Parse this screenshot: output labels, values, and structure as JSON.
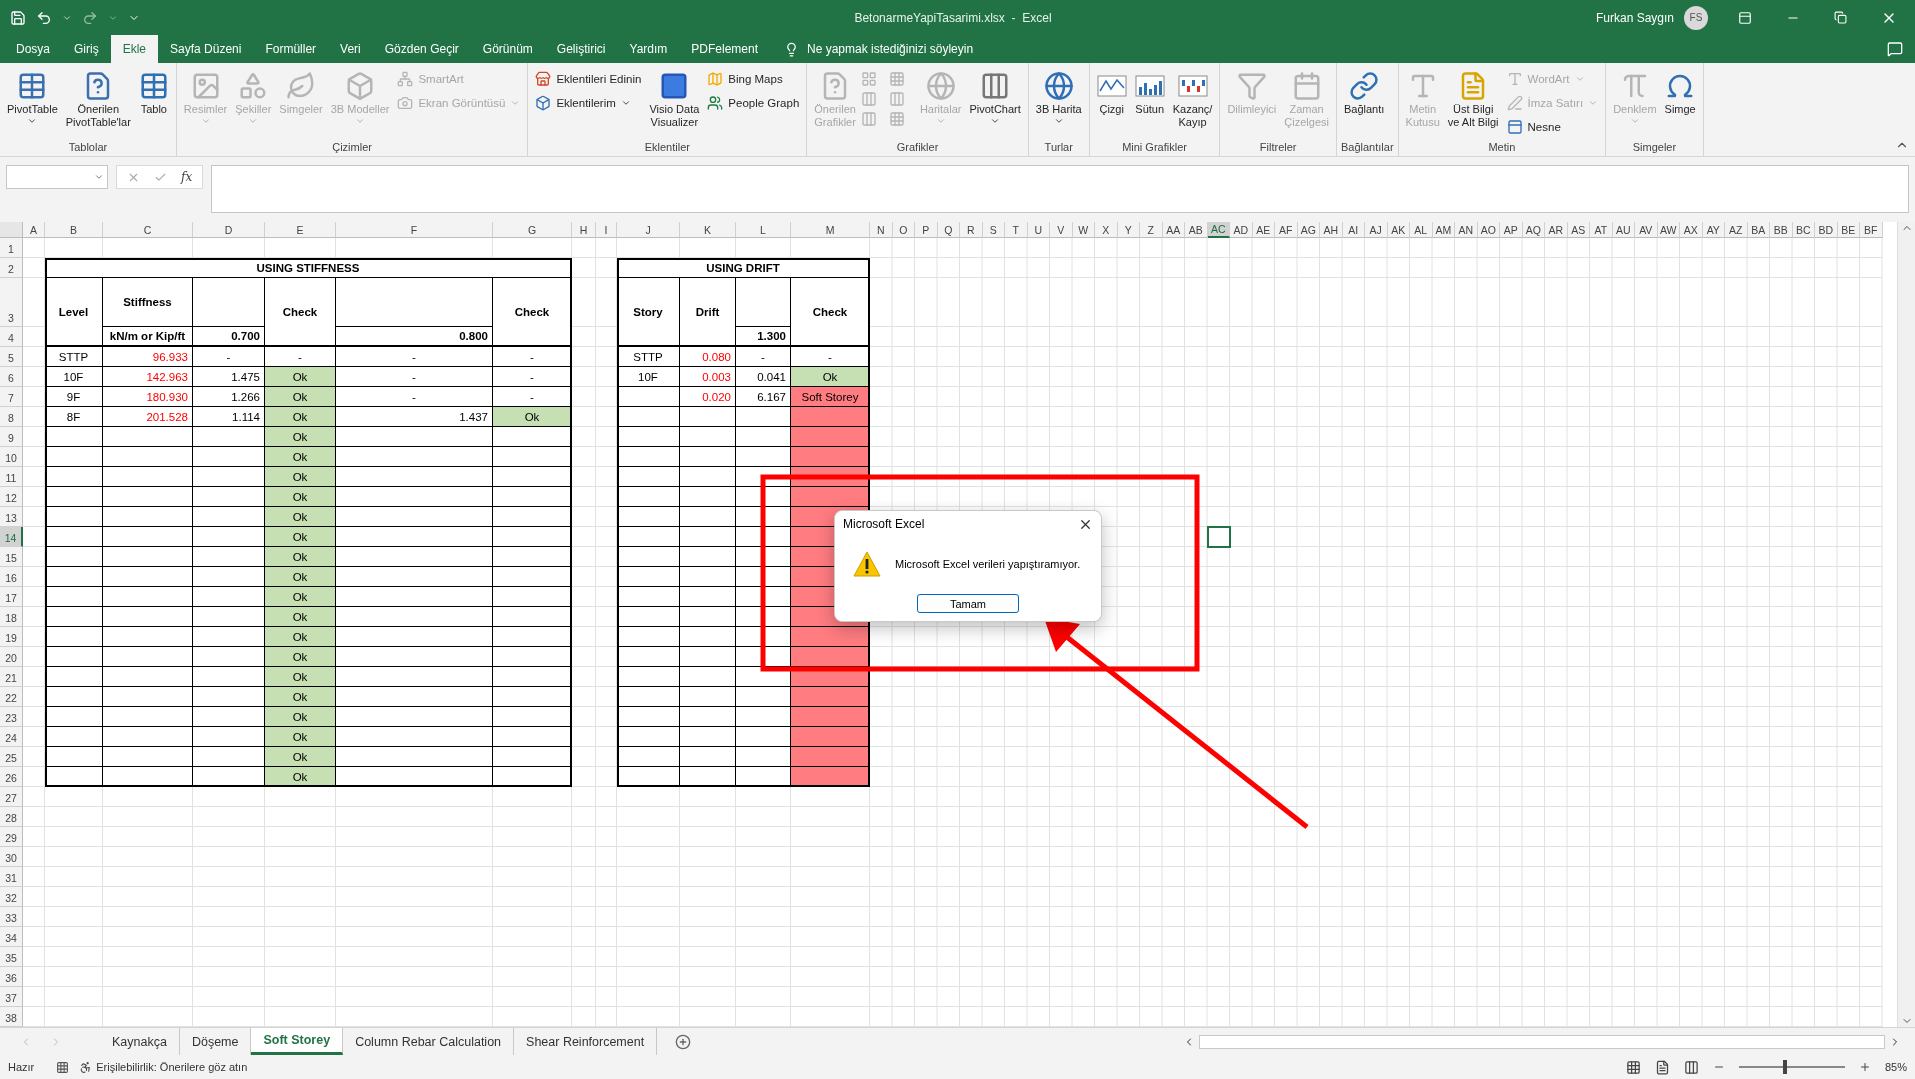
{
  "title_bar": {
    "title": "BetonarmeYapiTasarimi.xlsx  -  Excel",
    "user": "Furkan Saygın",
    "avatar": "FS"
  },
  "menu": {
    "tabs": [
      {
        "label": "Dosya",
        "selected": false
      },
      {
        "label": "Giriş",
        "selected": false
      },
      {
        "label": "Ekle",
        "selected": true
      },
      {
        "label": "Sayfa Düzeni",
        "selected": false
      },
      {
        "label": "Formüller",
        "selected": false
      },
      {
        "label": "Veri",
        "selected": false
      },
      {
        "label": "Gözden Geçir",
        "selected": false
      },
      {
        "label": "Görünüm",
        "selected": false
      },
      {
        "label": "Geliştirici",
        "selected": false
      },
      {
        "label": "Yardım",
        "selected": false
      },
      {
        "label": "PDFelement",
        "selected": false
      }
    ],
    "tell_me": "Ne yapmak istediğinizi söyleyin"
  },
  "ribbon": {
    "groups": [
      {
        "label": "Tablolar",
        "items": [
          {
            "label": "PivotTable",
            "kind": "large",
            "disabled": false,
            "dropdown": true
          },
          {
            "label": "Önerilen\nPivotTable'lar",
            "kind": "large",
            "disabled": false,
            "dropdown": false
          },
          {
            "label": "Tablo",
            "kind": "large",
            "disabled": false,
            "dropdown": false
          }
        ]
      },
      {
        "label": "Çizimler",
        "items": [
          {
            "label": "Resimler",
            "kind": "large",
            "disabled": true,
            "dropdown": true
          },
          {
            "label": "Şekiller",
            "kind": "large",
            "disabled": true,
            "dropdown": true
          },
          {
            "label": "Simgeler",
            "kind": "large",
            "disabled": true,
            "dropdown": false
          },
          {
            "label": "3B Modeller",
            "kind": "large",
            "disabled": true,
            "dropdown": true
          },
          {
            "label": "SmartArt",
            "kind": "small",
            "disabled": true,
            "dropdown": false
          },
          {
            "label": "Ekran Görüntüsü",
            "kind": "small",
            "disabled": true,
            "dropdown": true
          }
        ]
      },
      {
        "label": "Eklentiler",
        "items": [
          {
            "label": "Eklentileri Edinin",
            "kind": "small",
            "disabled": false,
            "dropdown": false
          },
          {
            "label": "Eklentilerim",
            "kind": "small",
            "disabled": false,
            "dropdown": true
          },
          {
            "label": "Visio Data\nVisualizer",
            "kind": "large",
            "disabled": false,
            "dropdown": false
          },
          {
            "label": "Bing Maps",
            "kind": "small",
            "disabled": false,
            "dropdown": false
          },
          {
            "label": "People Graph",
            "kind": "small",
            "disabled": false,
            "dropdown": false
          }
        ]
      },
      {
        "label": "Grafikler",
        "items": [
          {
            "label": "Önerilen\nGrafikler",
            "kind": "large",
            "disabled": true,
            "dropdown": false
          },
          {
            "kind": "icon-grid",
            "disabled": true
          },
          {
            "label": "Haritalar",
            "kind": "large",
            "disabled": true,
            "dropdown": true
          },
          {
            "label": "PivotChart",
            "kind": "large",
            "disabled": false,
            "dropdown": true
          }
        ]
      },
      {
        "label": "Turlar",
        "items": [
          {
            "label": "3B Harita",
            "kind": "large",
            "disabled": false,
            "dropdown": true
          }
        ]
      },
      {
        "label": "Mini Grafikler",
        "items": [
          {
            "label": "Çizgi",
            "kind": "large",
            "disabled": false,
            "dropdown": false
          },
          {
            "label": "Sütun",
            "kind": "large",
            "disabled": false,
            "dropdown": false
          },
          {
            "label": "Kazanç/\nKayıp",
            "kind": "large",
            "disabled": false,
            "dropdown": false
          }
        ]
      },
      {
        "label": "Filtreler",
        "items": [
          {
            "label": "Dilimleyici",
            "kind": "large",
            "disabled": true,
            "dropdown": false
          },
          {
            "label": "Zaman\nÇizelgesi",
            "kind": "large",
            "disabled": true,
            "dropdown": false
          }
        ]
      },
      {
        "label": "Bağlantılar",
        "items": [
          {
            "label": "Bağlantı",
            "kind": "large",
            "disabled": false,
            "dropdown": false
          }
        ]
      },
      {
        "label": "Metin",
        "items": [
          {
            "label": "Metin\nKutusu",
            "kind": "large",
            "disabled": true,
            "dropdown": false
          },
          {
            "label": "Üst Bilgi\nve Alt Bilgi",
            "kind": "large",
            "disabled": false,
            "dropdown": false
          },
          {
            "label": "WordArt",
            "kind": "small",
            "disabled": true,
            "dropdown": true
          },
          {
            "label": "İmza Satırı",
            "kind": "small",
            "disabled": true,
            "dropdown": true
          },
          {
            "label": "Nesne",
            "kind": "small",
            "disabled": false,
            "dropdown": false
          }
        ]
      },
      {
        "label": "Simgeler",
        "items": [
          {
            "label": "Denklem",
            "kind": "large",
            "disabled": true,
            "dropdown": true
          },
          {
            "label": "Simge",
            "kind": "large",
            "disabled": false,
            "dropdown": false
          }
        ]
      }
    ]
  },
  "formula_bar": {
    "function_label": "fx"
  },
  "sheet": {
    "columns": [
      {
        "label": "A",
        "selected": false
      },
      {
        "label": "B",
        "selected": false
      },
      {
        "label": "C",
        "selected": false
      },
      {
        "label": "D",
        "selected": false
      },
      {
        "label": "E",
        "selected": false
      },
      {
        "label": "F",
        "selected": false
      },
      {
        "label": "G",
        "selected": false
      },
      {
        "label": "H",
        "selected": false
      },
      {
        "label": "I",
        "selected": false
      },
      {
        "label": "J",
        "selected": false
      },
      {
        "label": "K",
        "selected": false
      },
      {
        "label": "L",
        "selected": false
      },
      {
        "label": "M",
        "selected": false
      },
      {
        "label": "N",
        "selected": false
      },
      {
        "label": "O",
        "selected": false
      },
      {
        "label": "P",
        "selected": false
      },
      {
        "label": "Q",
        "selected": false
      },
      {
        "label": "R",
        "selected": false
      },
      {
        "label": "S",
        "selected": false
      },
      {
        "label": "T",
        "selected": false
      },
      {
        "label": "U",
        "selected": false
      },
      {
        "label": "V",
        "selected": false
      },
      {
        "label": "W",
        "selected": false
      },
      {
        "label": "X",
        "selected": false
      },
      {
        "label": "Y",
        "selected": false
      },
      {
        "label": "Z",
        "selected": false
      },
      {
        "label": "AA",
        "selected": false
      },
      {
        "label": "AB",
        "selected": false
      },
      {
        "label": "AC",
        "selected": true
      },
      {
        "label": "AD",
        "selected": false
      },
      {
        "label": "AE",
        "selected": false
      },
      {
        "label": "AF",
        "selected": false
      },
      {
        "label": "AG",
        "selected": false
      },
      {
        "label": "AH",
        "selected": false
      },
      {
        "label": "AI",
        "selected": false
      },
      {
        "label": "AJ",
        "selected": false
      },
      {
        "label": "AK",
        "selected": false
      },
      {
        "label": "AL",
        "selected": false
      },
      {
        "label": "AM",
        "selected": false
      },
      {
        "label": "AN",
        "selected": false
      },
      {
        "label": "AO",
        "selected": false
      },
      {
        "label": "AP",
        "selected": false
      },
      {
        "label": "AQ",
        "selected": false
      },
      {
        "label": "AR",
        "selected": false
      },
      {
        "label": "AS",
        "selected": false
      },
      {
        "label": "AT",
        "selected": false
      },
      {
        "label": "AU",
        "selected": false
      },
      {
        "label": "AV",
        "selected": false
      },
      {
        "label": "AW",
        "selected": false
      },
      {
        "label": "AX",
        "selected": false
      },
      {
        "label": "AY",
        "selected": false
      },
      {
        "label": "AZ",
        "selected": false
      },
      {
        "label": "BA",
        "selected": false
      },
      {
        "label": "BB",
        "selected": false
      },
      {
        "label": "BC",
        "selected": false
      },
      {
        "label": "BD",
        "selected": false
      },
      {
        "label": "BE",
        "selected": false
      },
      {
        "label": "BF",
        "selected": false
      }
    ],
    "rows": [
      {
        "label": "1",
        "selected": false
      },
      {
        "label": "2",
        "selected": false
      },
      {
        "label": "3",
        "selected": false
      },
      {
        "label": "4",
        "selected": false
      },
      {
        "label": "5",
        "selected": false
      },
      {
        "label": "6",
        "selected": false
      },
      {
        "label": "7",
        "selected": false
      },
      {
        "label": "8",
        "selected": false
      },
      {
        "label": "9",
        "selected": false
      },
      {
        "label": "10",
        "selected": false
      },
      {
        "label": "11",
        "selected": false
      },
      {
        "label": "12",
        "selected": false
      },
      {
        "label": "13",
        "selected": false
      },
      {
        "label": "14",
        "selected": true
      },
      {
        "label": "15",
        "selected": false
      },
      {
        "label": "16",
        "selected": false
      },
      {
        "label": "17",
        "selected": false
      },
      {
        "label": "18",
        "selected": false
      },
      {
        "label": "19",
        "selected": false
      },
      {
        "label": "20",
        "selected": false
      },
      {
        "label": "21",
        "selected": false
      },
      {
        "label": "22",
        "selected": false
      },
      {
        "label": "23",
        "selected": false
      },
      {
        "label": "24",
        "selected": false
      },
      {
        "label": "25",
        "selected": false
      },
      {
        "label": "26",
        "selected": false
      },
      {
        "label": "27",
        "selected": false
      },
      {
        "label": "28",
        "selected": false
      },
      {
        "label": "29",
        "selected": false
      },
      {
        "label": "30",
        "selected": false
      },
      {
        "label": "31",
        "selected": false
      },
      {
        "label": "32",
        "selected": false
      },
      {
        "label": "33",
        "selected": false
      },
      {
        "label": "34",
        "selected": false
      },
      {
        "label": "35",
        "selected": false
      },
      {
        "label": "36",
        "selected": false
      },
      {
        "label": "37",
        "selected": false
      },
      {
        "label": "38",
        "selected": false
      }
    ],
    "tables": [
      {
        "title": "USING STIFFNESS",
        "header": [
          {
            "kind": "tall",
            "text": "Level"
          },
          {
            "kind": "split",
            "text": "Stiffness",
            "sub": "kN/m or Kip/ft"
          },
          {
            "kind": "split",
            "sub": "0.700"
          },
          {
            "kind": "tall",
            "text": "Check"
          },
          {
            "kind": "split",
            "sub": "0.800"
          },
          {
            "kind": "tall",
            "text": "Check"
          }
        ],
        "rows": [
          [
            {
              "text": "STTP"
            },
            {
              "text": "96.933",
              "kind": "input"
            },
            {
              "text": "-"
            },
            {
              "text": "-"
            },
            {
              "text": "-"
            },
            {
              "text": "-"
            }
          ],
          [
            {
              "text": "10F"
            },
            {
              "text": "142.963",
              "kind": "input"
            },
            {
              "text": "1.475",
              "kind": "number"
            },
            {
              "text": "Ok",
              "color": "#c6e0b4"
            },
            {
              "text": "-"
            },
            {
              "text": "-"
            }
          ],
          [
            {
              "text": "9F"
            },
            {
              "text": "180.930",
              "kind": "input"
            },
            {
              "text": "1.266",
              "kind": "number"
            },
            {
              "text": "Ok",
              "color": "#c6e0b4"
            },
            {
              "text": "-"
            },
            {
              "text": "-"
            }
          ],
          [
            {
              "text": "8F"
            },
            {
              "text": "201.528",
              "kind": "input"
            },
            {
              "text": "1.114",
              "kind": "number"
            },
            {
              "text": "Ok",
              "color": "#c6e0b4"
            },
            {
              "text": "1.437",
              "kind": "number"
            },
            {
              "text": "Ok",
              "color": "#c6e0b4"
            }
          ],
          [
            {},
            {},
            {},
            {
              "text": "Ok",
              "color": "#c6e0b4"
            },
            {},
            {}
          ],
          [
            {},
            {},
            {},
            {
              "text": "Ok",
              "color": "#c6e0b4"
            },
            {},
            {}
          ],
          [
            {},
            {},
            {},
            {
              "text": "Ok",
              "color": "#c6e0b4"
            },
            {},
            {}
          ],
          [
            {},
            {},
            {},
            {
              "text": "Ok",
              "color": "#c6e0b4"
            },
            {},
            {}
          ],
          [
            {},
            {},
            {},
            {
              "text": "Ok",
              "color": "#c6e0b4"
            },
            {},
            {}
          ],
          [
            {},
            {},
            {},
            {
              "text": "Ok",
              "color": "#c6e0b4"
            },
            {},
            {}
          ],
          [
            {},
            {},
            {},
            {
              "text": "Ok",
              "color": "#c6e0b4"
            },
            {},
            {}
          ],
          [
            {},
            {},
            {},
            {
              "text": "Ok",
              "color": "#c6e0b4"
            },
            {},
            {}
          ],
          [
            {},
            {},
            {},
            {
              "text": "Ok",
              "color": "#c6e0b4"
            },
            {},
            {}
          ],
          [
            {},
            {},
            {},
            {
              "text": "Ok",
              "color": "#c6e0b4"
            },
            {},
            {}
          ],
          [
            {},
            {},
            {},
            {
              "text": "Ok",
              "color": "#c6e0b4"
            },
            {},
            {}
          ],
          [
            {},
            {},
            {},
            {
              "text": "Ok",
              "color": "#c6e0b4"
            },
            {},
            {}
          ],
          [
            {},
            {},
            {},
            {
              "text": "Ok",
              "color": "#c6e0b4"
            },
            {},
            {}
          ],
          [
            {},
            {},
            {},
            {
              "text": "Ok",
              "color": "#c6e0b4"
            },
            {},
            {}
          ],
          [
            {},
            {},
            {},
            {
              "text": "Ok",
              "color": "#c6e0b4"
            },
            {},
            {}
          ],
          [
            {},
            {},
            {},
            {
              "text": "Ok",
              "color": "#c6e0b4"
            },
            {},
            {}
          ],
          [
            {},
            {},
            {},
            {
              "text": "Ok",
              "color": "#c6e0b4"
            },
            {},
            {}
          ],
          [
            {},
            {},
            {},
            {
              "text": "Ok",
              "color": "#c6e0b4"
            },
            {},
            {}
          ]
        ]
      },
      {
        "title": "USING DRIFT",
        "header": [
          {
            "kind": "tall",
            "text": "Story"
          },
          {
            "kind": "tall",
            "text": "Drift"
          },
          {
            "kind": "split",
            "sub": "1.300"
          },
          {
            "kind": "tall",
            "text": "Check"
          }
        ],
        "rows": [
          [
            {
              "text": "STTP"
            },
            {
              "text": "0.080",
              "kind": "input"
            },
            {
              "text": "-"
            },
            {
              "text": "-"
            }
          ],
          [
            {
              "text": "10F"
            },
            {
              "text": "0.003",
              "kind": "input"
            },
            {
              "text": "0.041",
              "kind": "number"
            },
            {
              "text": "Ok",
              "color": "#c6e0b4"
            }
          ],
          [
            {},
            {
              "text": "0.020",
              "kind": "input"
            },
            {
              "text": "6.167",
              "kind": "number"
            },
            {
              "text": "Soft Storey",
              "color": "#ff7c80"
            }
          ],
          [
            {},
            {},
            {},
            {
              "color": "#ff7c80"
            }
          ],
          [
            {},
            {},
            {},
            {
              "color": "#ff7c80"
            }
          ],
          [
            {},
            {},
            {},
            {
              "color": "#ff7c80"
            }
          ],
          [
            {},
            {},
            {},
            {
              "color": "#ff7c80"
            }
          ],
          [
            {},
            {},
            {},
            {
              "color": "#ff7c80"
            }
          ],
          [
            {},
            {},
            {},
            {
              "color": "#ff7c80"
            }
          ],
          [
            {},
            {},
            {},
            {
              "color": "#ff7c80"
            }
          ],
          [
            {},
            {},
            {},
            {
              "color": "#ff7c80"
            }
          ],
          [
            {},
            {},
            {},
            {
              "color": "#ff7c80"
            }
          ],
          [
            {},
            {},
            {},
            {
              "color": "#ff7c80"
            }
          ],
          [
            {},
            {},
            {},
            {
              "color": "#ff7c80"
            }
          ],
          [
            {},
            {},
            {},
            {
              "color": "#ff7c80"
            }
          ],
          [
            {},
            {},
            {},
            {
              "color": "#ff7c80"
            }
          ],
          [
            {},
            {},
            {},
            {
              "color": "#ff7c80"
            }
          ],
          [
            {},
            {},
            {},
            {
              "color": "#ff7c80"
            }
          ],
          [
            {},
            {},
            {},
            {
              "color": "#ff7c80"
            }
          ],
          [
            {},
            {},
            {},
            {
              "color": "#ff7c80"
            }
          ],
          [
            {},
            {},
            {},
            {
              "color": "#ff7c80"
            }
          ],
          [
            {},
            {},
            {},
            {
              "color": "#ff7c80"
            }
          ]
        ]
      }
    ]
  },
  "sheet_tabs": [
    {
      "label": "Kaynakça",
      "selected": false
    },
    {
      "label": "Döşeme",
      "selected": false
    },
    {
      "label": "Soft Storey",
      "selected": true
    },
    {
      "label": "Column Rebar Calculation",
      "selected": false
    },
    {
      "label": "Shear Reinforcement",
      "selected": false
    }
  ],
  "status_bar": {
    "mode": "Hazır",
    "accessibility": "Erişilebilirlik: Önerilere göz atın",
    "zoom": {
      "level": 0.43,
      "reading": "85%"
    }
  },
  "dialog": {
    "title": "Microsoft Excel",
    "message": "Microsoft Excel verileri yapıştıramıyor.",
    "button": "Tamam"
  }
}
